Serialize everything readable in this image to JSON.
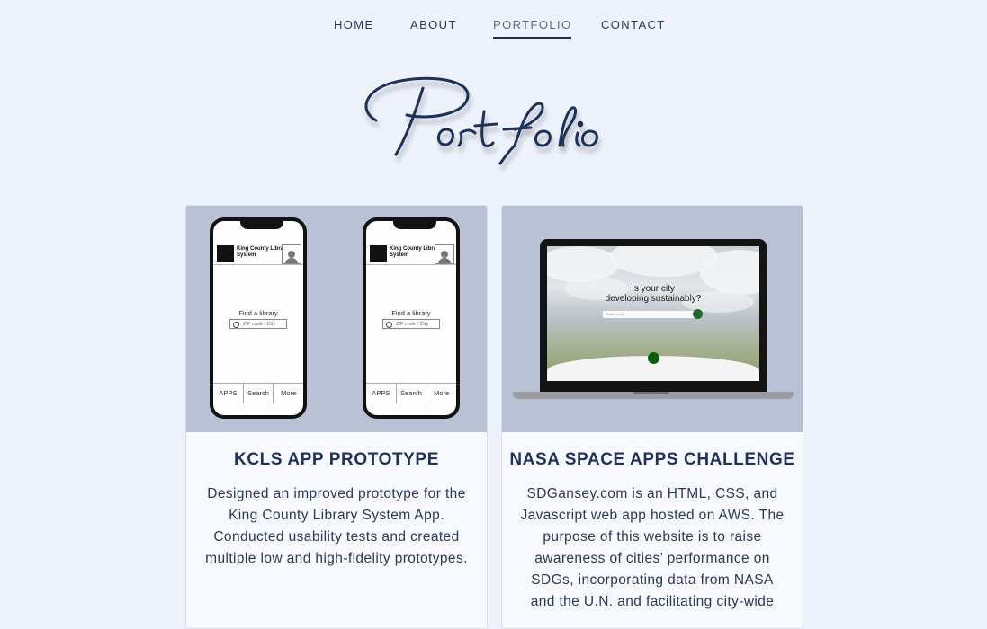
{
  "nav": {
    "items": [
      {
        "label": "HOME"
      },
      {
        "label": "ABOUT"
      },
      {
        "label": "PORTFOLIO"
      },
      {
        "label": "CONTACT"
      }
    ],
    "active": "PORTFOLIO"
  },
  "page": {
    "title": "Portfolio"
  },
  "cards": [
    {
      "title": "KCLS APP PROTOTYPE",
      "description": "Designed an improved prototype for the King County Library System App. Conducted usability tests and created multiple low and high-fidelity prototypes.",
      "mock": {
        "brand": "King County Library System",
        "find_label": "Find a library",
        "zip_placeholder": "ZIP code / City",
        "tabs": [
          "APPS",
          "Search",
          "More"
        ]
      }
    },
    {
      "title": "NASA SPACE APPS CHALLENGE",
      "description": "SDGansey.com is an HTML, CSS, and Javascript web app hosted on AWS. The purpose of this website is to raise awareness of cities’ performance on SDGs, incorporating data from NASA and the U.N. and facilitating city-wide",
      "mock": {
        "headline_1": "Is your city",
        "headline_2": "developing sustainably?",
        "search_placeholder": "Enter a city"
      }
    }
  ],
  "colors": {
    "page_bg": "#eef2fc",
    "primary_text": "#1f3358",
    "image_bg": "#b9c1d5"
  }
}
